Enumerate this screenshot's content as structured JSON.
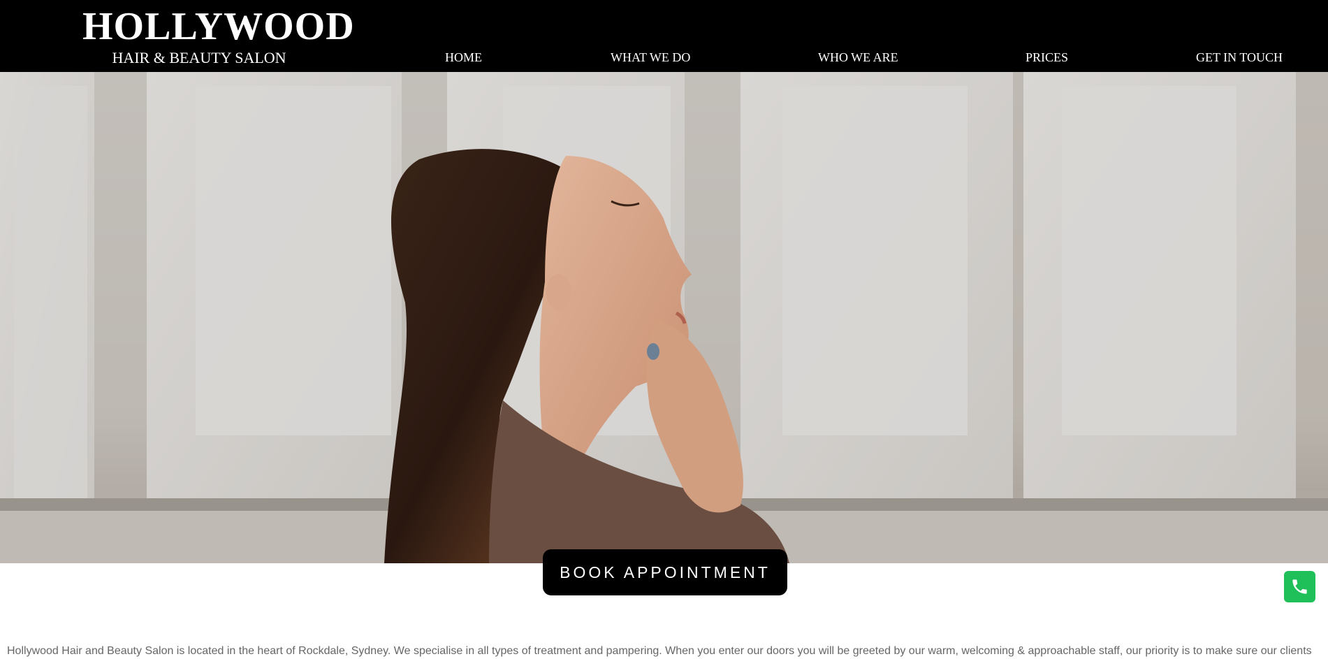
{
  "header": {
    "logo_title": "HOLLYWOOD",
    "logo_subtitle": "HAIR & BEAUTY SALON",
    "background": "#000000"
  },
  "nav": {
    "items": [
      {
        "label": "HOME"
      },
      {
        "label": "WHAT WE DO"
      },
      {
        "label": "WHO WE ARE"
      },
      {
        "label": "PRICES"
      },
      {
        "label": "GET IN TOUCH"
      }
    ]
  },
  "hero": {
    "image": "woman-profile-photo"
  },
  "cta": {
    "book_label": "BOOK APPOINTMENT"
  },
  "floating": {
    "phone_icon": "phone-icon",
    "phone_color": "#1fbf5a"
  },
  "intro": {
    "text": "Hollywood Hair and Beauty Salon is located in the heart of Rockdale, Sydney. We specialise in all types of treatment and pampering. When you enter our doors you will be greeted by our warm, welcoming & approachable staff, our priority is to make sure our clients"
  }
}
